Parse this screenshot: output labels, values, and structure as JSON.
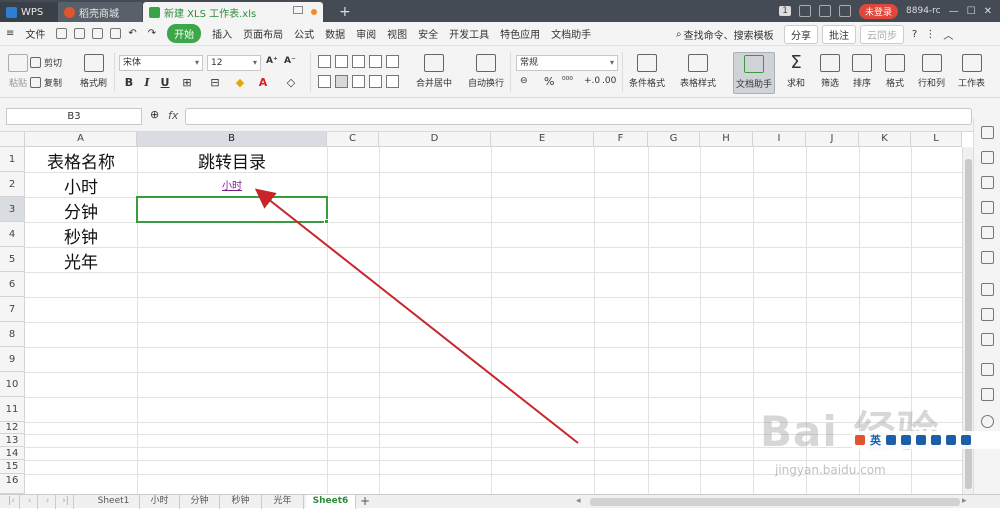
{
  "titlebar": {
    "tabs": [
      {
        "label": "WPS"
      },
      {
        "label": "稻壳商城"
      },
      {
        "label": "新建 XLS 工作表.xls"
      }
    ],
    "page_num": "1",
    "login_label": "未登录",
    "user_label": "8894-rc"
  },
  "menubar": {
    "file_label": "文件",
    "items": [
      "开始",
      "插入",
      "页面布局",
      "公式",
      "数据",
      "审阅",
      "视图",
      "安全",
      "开发工具",
      "特色应用",
      "文档助手"
    ],
    "search_label": "查找命令、搜索模板",
    "share_label": "分享",
    "comment_label": "批注",
    "sync_label": "云同步"
  },
  "ribbon": {
    "paste_label": "粘贴",
    "cut_label": "剪切",
    "copy_label": "复制",
    "format_painter_label": "格式刷",
    "font_name": "宋体",
    "font_size": "12",
    "merge_label": "合并居中",
    "wrap_label": "自动换行",
    "number_format": "常规",
    "cond_format_label": "条件格式",
    "table_style_label": "表格样式",
    "doc_helper_label": "文档助手",
    "sum_label": "求和",
    "filter_label": "筛选",
    "sort_label": "排序",
    "format_label": "格式",
    "rowcol_label": "行和列",
    "sheet_label": "工作表"
  },
  "formula": {
    "namebox": "B3",
    "fx": "fx",
    "value": ""
  },
  "grid": {
    "columns": [
      "A",
      "B",
      "C",
      "D",
      "E",
      "F",
      "G",
      "H",
      "I",
      "J",
      "K",
      "L"
    ],
    "rows": [
      "1",
      "2",
      "3",
      "4",
      "5",
      "6",
      "7",
      "8",
      "9",
      "10",
      "11",
      "12",
      "13",
      "14",
      "15",
      "16"
    ],
    "selected_cell": "B3",
    "cells": {
      "A1": "表格名称",
      "A2": "小时",
      "A3": "分钟",
      "A4": "秒钟",
      "A5": "光年",
      "B1": "跳转目录",
      "B2": "小时"
    },
    "arrow_color": "#c8252b",
    "selection_color": "#3b9a3e",
    "hyperlink_color": "#7a1f8c"
  },
  "sheets": {
    "tabs": [
      "Sheet1",
      "小时",
      "分钟",
      "秒钟",
      "光年",
      "Sheet6"
    ],
    "active": "Sheet6",
    "add_label": "+"
  },
  "watermark": {
    "text": "Bai 经验",
    "url": "jingyan.baidu.com",
    "ime_label": "英"
  }
}
